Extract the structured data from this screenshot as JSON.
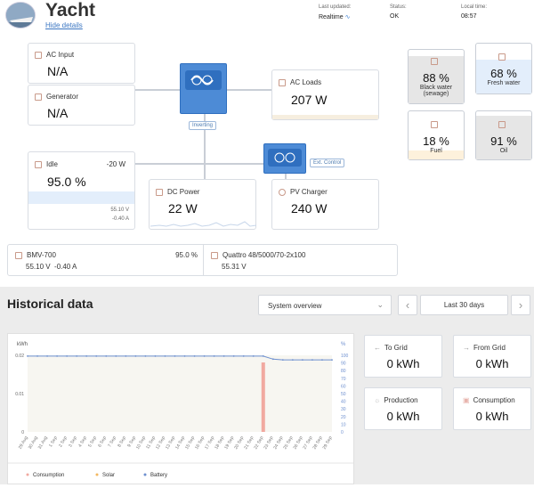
{
  "header": {
    "title": "Yacht",
    "hide_details": "Hide details",
    "last_updated_label": "Last updated:",
    "last_updated_value": "Realtime",
    "status_label": "Status:",
    "status_value": "OK",
    "local_time_label": "Local time:",
    "local_time_value": "08:57"
  },
  "ac_input": {
    "label": "AC Input",
    "value": "N/A"
  },
  "generator": {
    "label": "Generator",
    "value": "N/A"
  },
  "ac_loads": {
    "label": "AC Loads",
    "value": "207 W"
  },
  "inverter_tag": "Inverting",
  "ext_control_tag": "Ext. Control",
  "battery": {
    "label": "Idle",
    "power": "-20 W",
    "soc": "95.0 %",
    "voltage": "55.10 V",
    "current": "-0.40 A"
  },
  "dc_power": {
    "label": "DC Power",
    "value": "22 W"
  },
  "pv_charger": {
    "label": "PV Charger",
    "value": "240 W"
  },
  "tanks": [
    {
      "pct": "88 %",
      "name": "Black water",
      "name2": "(sewage)",
      "color": "#e6e6e6"
    },
    {
      "pct": "68 %",
      "name": "Fresh water",
      "color": "#e3eefb"
    },
    {
      "pct": "18 %",
      "name": "Fuel",
      "color": "#fdf1dc"
    },
    {
      "pct": "91 %",
      "name": "Oil",
      "color": "#e6e6e6"
    }
  ],
  "devices": [
    {
      "name": "BMV-700",
      "value": "95.0 %",
      "sub": "55.10 V  -0.40 A"
    },
    {
      "name": "Quattro 48/5000/70-2x100",
      "value": "",
      "sub": "55.31 V"
    }
  ],
  "historical": {
    "title": "Historical data",
    "dropdown": "System overview",
    "range": "Last 30 days",
    "prev": "‹",
    "next": "›"
  },
  "chart_data": {
    "type": "line",
    "ylabel": "kWh",
    "y2label": "%",
    "ylim": [
      0,
      0.02
    ],
    "y2lim": [
      0,
      100
    ],
    "y_ticks": [
      "0.02",
      "0.01",
      "0"
    ],
    "y2_ticks": [
      "100",
      "90",
      "80",
      "70",
      "60",
      "50",
      "40",
      "30",
      "20",
      "10",
      "0"
    ],
    "x": [
      "29 Aug",
      "30 Aug",
      "31 Aug",
      "1 Sep",
      "2 Sep",
      "3 Sep",
      "4 Sep",
      "5 Sep",
      "6 Sep",
      "7 Sep",
      "8 Sep",
      "9 Sep",
      "10 Sep",
      "11 Sep",
      "12 Sep",
      "13 Sep",
      "14 Sep",
      "15 Sep",
      "16 Sep",
      "17 Sep",
      "18 Sep",
      "19 Sep",
      "20 Sep",
      "21 Sep",
      "22 Sep",
      "23 Sep",
      "24 Sep",
      "25 Sep",
      "26 Sep",
      "27 Sep",
      "28 Sep",
      "29 Sep"
    ],
    "series": [
      {
        "name": "Consumption",
        "color": "#f1a9a0"
      },
      {
        "name": "Solar",
        "color": "#f4b860"
      },
      {
        "name": "Battery",
        "color": "#6d8fcf",
        "values": [
          99,
          99,
          99,
          99,
          99,
          99,
          99,
          99,
          99,
          99,
          99,
          99,
          99,
          99,
          99,
          99,
          99,
          99,
          99,
          99,
          99,
          99,
          99,
          99,
          99,
          95,
          94,
          94,
          94,
          94,
          94,
          94
        ]
      }
    ],
    "highlight_index": 24,
    "legend_position": "bottom-left"
  },
  "stats": [
    {
      "label": "To Grid",
      "value": "0 kWh",
      "arrow": "←"
    },
    {
      "label": "From Grid",
      "value": "0 kWh",
      "arrow": "→"
    },
    {
      "label": "Production",
      "value": "0 kWh",
      "arrow": "☼"
    },
    {
      "label": "Consumption",
      "value": "0 kWh",
      "arrow": "▣"
    }
  ]
}
